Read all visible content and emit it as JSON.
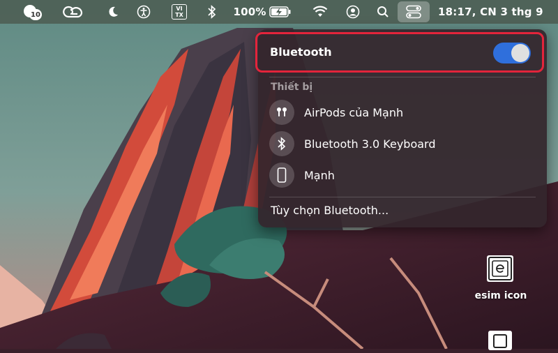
{
  "menubar": {
    "notification_count": "10",
    "input_source_top": "VI",
    "input_source_bottom": "TX",
    "battery_text": "100%",
    "clock_text": "18:17, CN 3 thg 9",
    "icons": [
      "notification-badge-icon",
      "creative-cloud-icon",
      "moon-icon",
      "accessibility-icon",
      "input-source-icon",
      "bluetooth-icon",
      "battery-charging-icon",
      "wifi-icon",
      "user-icon",
      "search-icon",
      "control-center-icon"
    ]
  },
  "bluetooth_panel": {
    "title": "Bluetooth",
    "toggle_on": true,
    "section_label": "Thiết bị",
    "devices": [
      {
        "name": "AirPods của Mạnh",
        "icon": "airpods-icon"
      },
      {
        "name": "Bluetooth 3.0 Keyboard",
        "icon": "bluetooth-icon"
      },
      {
        "name": "Mạnh",
        "icon": "phone-icon"
      }
    ],
    "options_label": "Tùy chọn Bluetooth..."
  },
  "desktop": {
    "icons": [
      {
        "label": "esim icon",
        "icon": "file-icon"
      }
    ]
  },
  "colors": {
    "toggle_accent": "#2f6fdc",
    "highlight_border": "#e3243b"
  }
}
